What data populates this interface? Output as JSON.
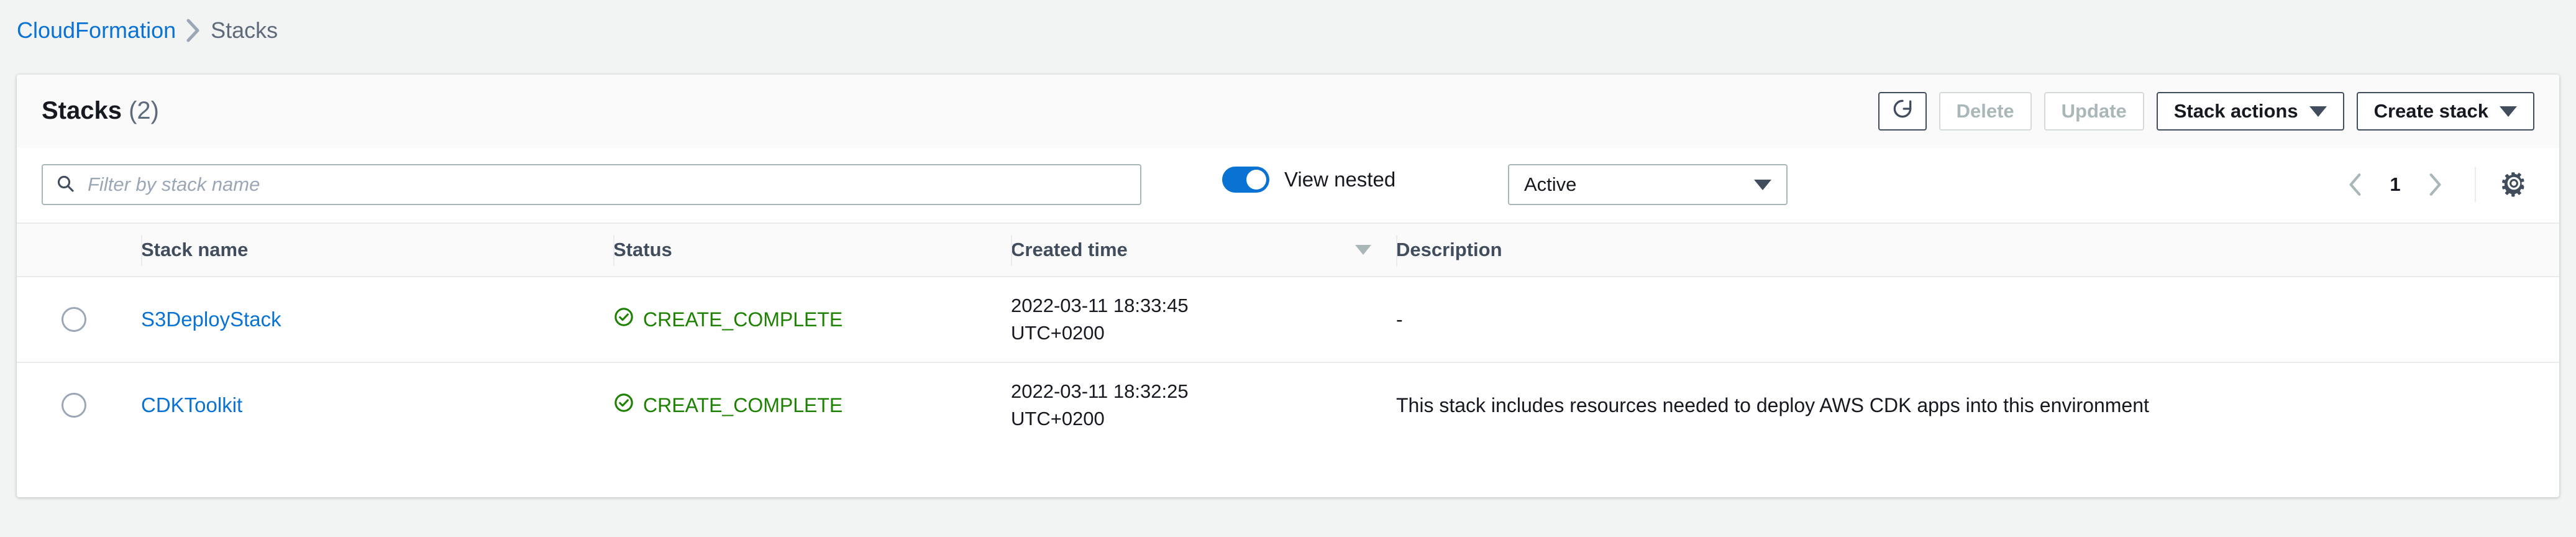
{
  "breadcrumb": {
    "root_label": "CloudFormation",
    "separator_icon": "chevron-right-icon",
    "current_label": "Stacks"
  },
  "panel": {
    "title": "Stacks",
    "count": "(2)",
    "actions": {
      "refresh_icon": "refresh-icon",
      "delete_label": "Delete",
      "update_label": "Update",
      "stack_actions_label": "Stack actions",
      "create_stack_label": "Create stack"
    }
  },
  "filters": {
    "search_placeholder": "Filter by stack name",
    "search_value": "",
    "search_icon": "search-icon",
    "view_nested_label": "View nested",
    "view_nested_on": true,
    "status_filter_value": "Active",
    "status_filter_options": [
      "Active"
    ],
    "pagination": {
      "prev_icon": "chevron-left-icon",
      "next_icon": "chevron-right-icon",
      "current_page": "1"
    },
    "settings_icon": "gear-icon"
  },
  "table": {
    "columns": [
      {
        "key": "select",
        "label": ""
      },
      {
        "key": "name",
        "label": "Stack name"
      },
      {
        "key": "status",
        "label": "Status"
      },
      {
        "key": "created",
        "label": "Created time",
        "sorted": true,
        "sort_icon": "sort-desc-icon"
      },
      {
        "key": "description",
        "label": "Description"
      }
    ],
    "rows": [
      {
        "name": "S3DeployStack",
        "status": "CREATE_COMPLETE",
        "status_icon": "status-success-icon",
        "created_date": "2022-03-11 18:33:45",
        "created_tz": "UTC+0200",
        "description": "-"
      },
      {
        "name": "CDKToolkit",
        "status": "CREATE_COMPLETE",
        "status_icon": "status-success-icon",
        "created_date": "2022-03-11 18:32:25",
        "created_tz": "UTC+0200",
        "description": "This stack includes resources needed to deploy AWS CDK apps into this environment"
      }
    ]
  },
  "colors": {
    "link": "#0972d3",
    "success": "#1d8102",
    "page_bg": "#f2f3f3",
    "header_bg": "#fafafa",
    "border": "#e9ebed",
    "text": "#16191f",
    "muted": "#5f6b7a"
  }
}
